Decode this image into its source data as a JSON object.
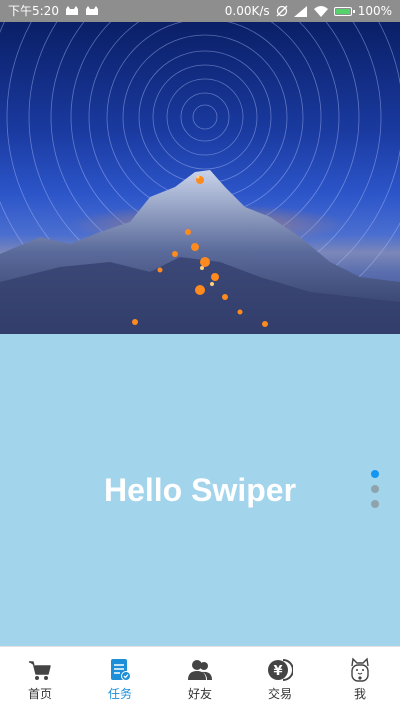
{
  "status_bar": {
    "time": "下午5:20",
    "network_speed": "0.00K/s",
    "battery": "100%",
    "icons": [
      "cat-icon",
      "cat-icon",
      "alarm-off-icon",
      "signal-icon",
      "wifi-icon",
      "battery-charging-icon"
    ]
  },
  "banner": {
    "image": "star-trail-mountain-photo"
  },
  "swiper": {
    "title": "Hello Swiper",
    "slide_count": 3,
    "active_index": 0,
    "background": "#a2d4ec",
    "active_dot_color": "#1296f2"
  },
  "tabbar": {
    "active_color": "#1d8fd8",
    "tabs": [
      {
        "label": "首页",
        "icon": "cart-icon",
        "active": false
      },
      {
        "label": "任务",
        "icon": "task-document-icon",
        "active": true
      },
      {
        "label": "好友",
        "icon": "friends-icon",
        "active": false
      },
      {
        "label": "交易",
        "icon": "yen-coin-icon",
        "active": false
      },
      {
        "label": "我",
        "icon": "lucky-cat-icon",
        "active": false
      }
    ]
  }
}
